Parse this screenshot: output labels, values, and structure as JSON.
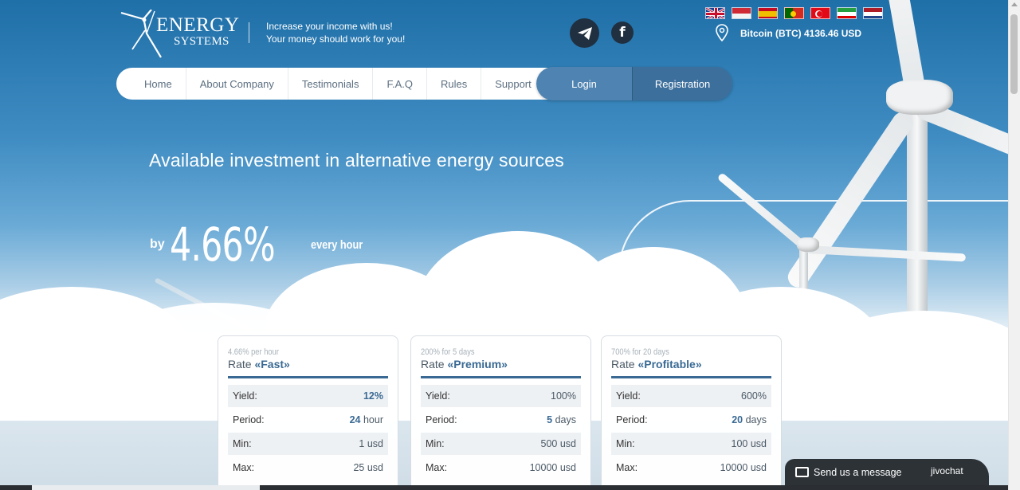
{
  "header": {
    "logo_word1": "ENERGY",
    "logo_word2": "SYSTEMS",
    "tagline_line1": "Increase your income with us!",
    "tagline_line2": "Your money should work for you!",
    "social": [
      {
        "name": "telegram-icon"
      },
      {
        "name": "facebook-icon",
        "glyph": "f"
      }
    ],
    "bitcoin_rate": "Bitcoin (BTC) 4136.46 USD",
    "languages": [
      {
        "name": "flag-uk"
      },
      {
        "name": "flag-indonesia"
      },
      {
        "name": "flag-spain"
      },
      {
        "name": "flag-portugal"
      },
      {
        "name": "flag-turkey"
      },
      {
        "name": "flag-iran"
      },
      {
        "name": "flag-netherlands"
      }
    ]
  },
  "nav": {
    "items": [
      "Home",
      "About Company",
      "Testimonials",
      "F.A.Q",
      "Rules",
      "Support"
    ],
    "login": "Login",
    "registration": "Registration"
  },
  "hero": {
    "headline": "Available investment in alternative energy sources",
    "by": "by",
    "rate": "4.66%",
    "every": "every hour"
  },
  "plans": [
    {
      "subtitle": "4.66% per hour",
      "rate_prefix": "Rate",
      "name": "«Fast»",
      "yield_label": "Yield:",
      "yield_value": "12%",
      "period_label": "Period:",
      "period_num": "24",
      "period_unit": "hour",
      "min_label": "Min:",
      "min_value": "1 usd",
      "max_label": "Max:",
      "max_value": "25 usd"
    },
    {
      "subtitle": "200% for 5 days",
      "rate_prefix": "Rate",
      "name": "«Premium»",
      "yield_label": "Yield:",
      "yield_value": "100%",
      "period_label": "Period:",
      "period_num": "5",
      "period_unit": "days",
      "min_label": "Min:",
      "min_value": "500 usd",
      "max_label": "Max:",
      "max_value": "10000 usd"
    },
    {
      "subtitle": "700% for 20 days",
      "rate_prefix": "Rate",
      "name": "«Profitable»",
      "yield_label": "Yield:",
      "yield_value": "600%",
      "period_label": "Period:",
      "period_num": "20",
      "period_unit": "days",
      "min_label": "Min:",
      "min_value": "100 usd",
      "max_label": "Max:",
      "max_value": "10000 usd"
    }
  ],
  "chat": {
    "label": "Send us a message",
    "brand": "jivochat"
  },
  "colors": {
    "accent": "#3a6a94",
    "login_bg": "#4f84b2",
    "registration_bg": "#3d6f9c",
    "chat_bg": "#2d3236"
  }
}
